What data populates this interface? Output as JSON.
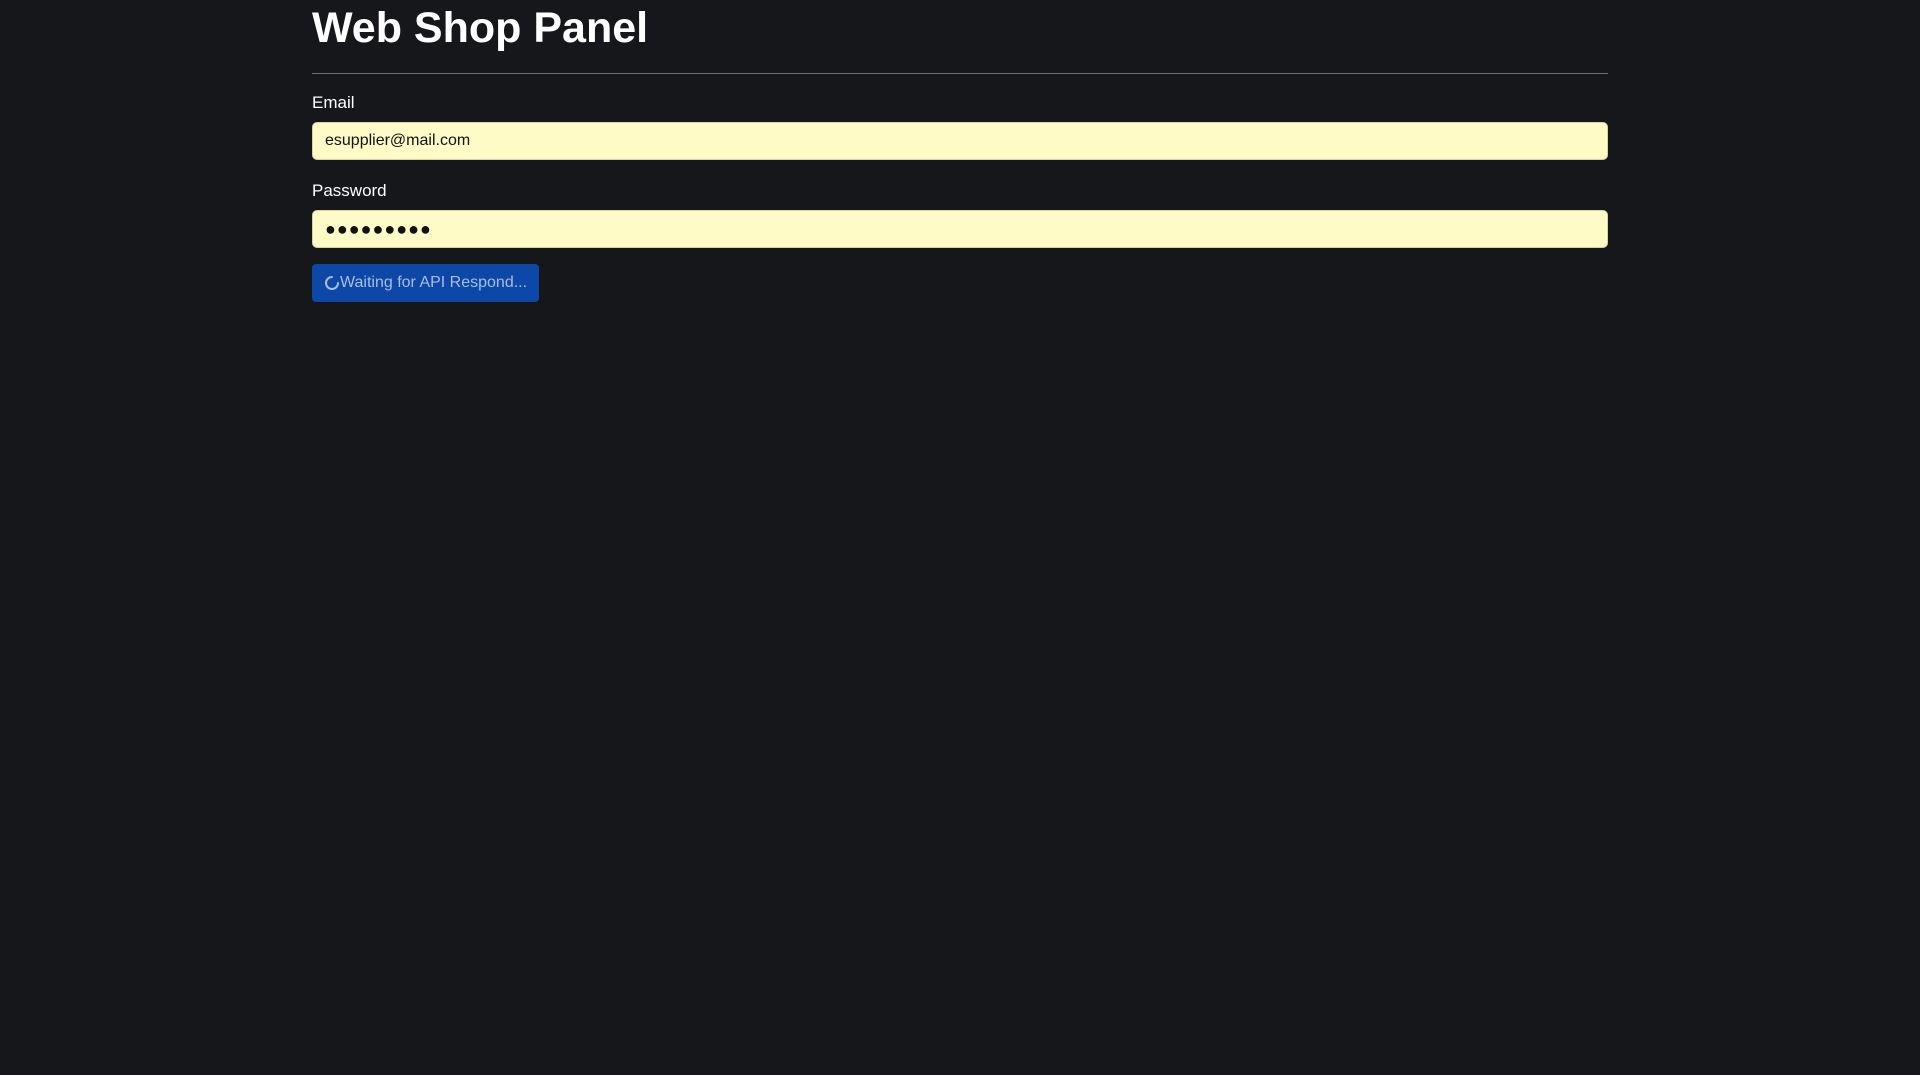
{
  "header": {
    "title": "Web Shop Panel"
  },
  "form": {
    "email": {
      "label": "Email",
      "value": "esupplier@mail.com"
    },
    "password": {
      "label": "Password",
      "masked_value": "●●●●●●●●●"
    },
    "submit": {
      "label": "Waiting for API Respond...",
      "icon": "spinner-icon"
    }
  },
  "colors": {
    "background": "#16171a",
    "input_autofill_bg": "#fffbc6",
    "button_bg": "#0d47a8",
    "button_text": "#a9bde0"
  }
}
